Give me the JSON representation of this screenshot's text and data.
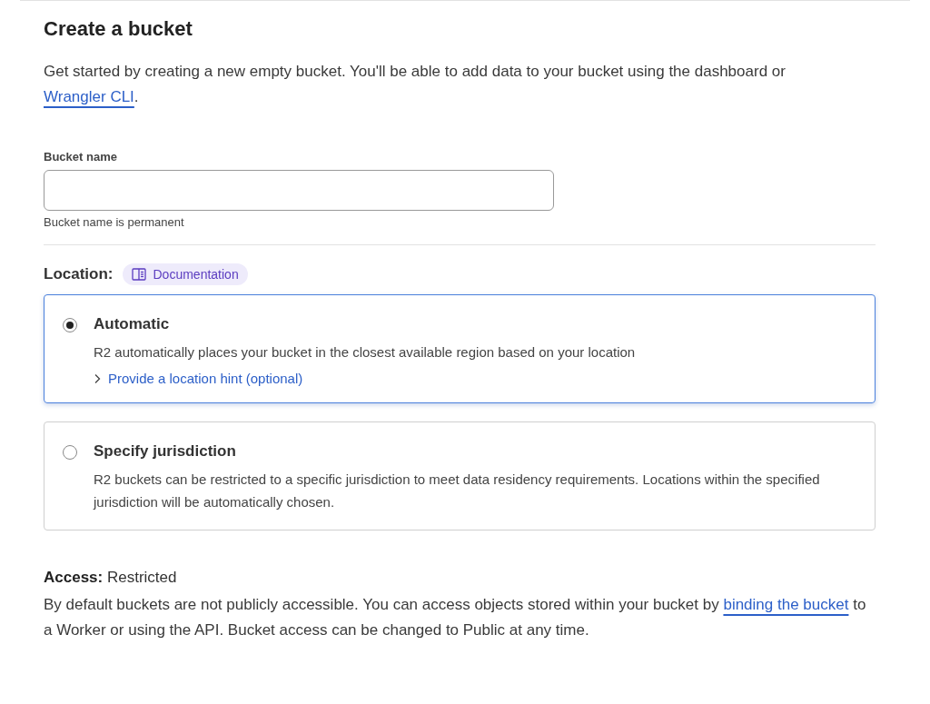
{
  "title": "Create a bucket",
  "intro": {
    "text": "Get started by creating a new empty bucket. You'll be able to add data to your bucket using the dashboard or",
    "link": "Wrangler CLI",
    "suffix": "."
  },
  "bucket_name": {
    "label": "Bucket name",
    "hint": "Bucket name is permanent"
  },
  "location": {
    "label": "Location:",
    "doc_link": "Documentation",
    "options": [
      {
        "title": "Automatic",
        "description": "R2 automatically places your bucket in the closest available region based on your location",
        "hint_link": "Provide a location hint (optional)",
        "selected": true
      },
      {
        "title": "Specify jurisdiction",
        "description": "R2 buckets can be restricted to a specific jurisdiction to meet data residency requirements. Locations within the specified jurisdiction will be automatically chosen.",
        "selected": false
      }
    ]
  },
  "access": {
    "heading": "**Access:** Restricted",
    "text_before": "By default buckets are not publicly accessible. You can access objects stored within your bucket by",
    "link": "binding the bucket",
    "text_after": "to a Worker or using the API. Bucket access can be changed to Public at any time."
  }
}
